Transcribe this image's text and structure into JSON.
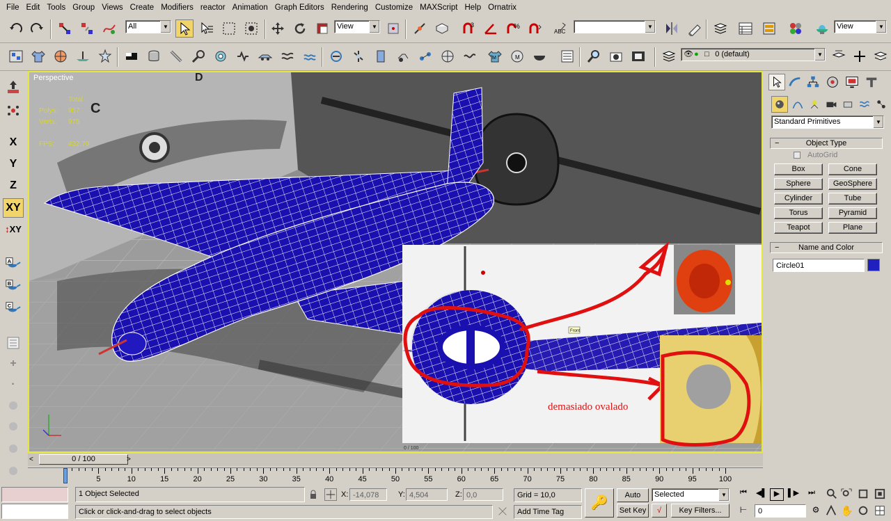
{
  "menu": [
    "File",
    "Edit",
    "Tools",
    "Group",
    "Views",
    "Create",
    "Modifiers",
    "reactor",
    "Animation",
    "Graph Editors",
    "Rendering",
    "Customize",
    "MAXScript",
    "Help",
    "Ornatrix"
  ],
  "toolbar": {
    "selection_filter": "All",
    "ref_coord": "View",
    "named_selection": "",
    "ref_coord2": "View",
    "layer": "0 (default)"
  },
  "left_strip": {
    "x": "X",
    "y": "Y",
    "z": "Z",
    "xy": "XY",
    "xy2": "XY",
    "a": "A",
    "b": "B",
    "c": "C"
  },
  "viewport": {
    "label": "Perspective",
    "stats_total": "Total",
    "stats_polys_label": "Polys:",
    "stats_polys": "957",
    "stats_verts_label": "Verts:",
    "stats_verts": "975",
    "stats_fps_label": "FPS:",
    "stats_fps": "432.79",
    "annotation": "demasiado ovalado",
    "front_label": "Front",
    "inset_frame": "0 / 100",
    "ref_letter_d": "D",
    "ref_letter_c": "C"
  },
  "command_panel": {
    "category": "Standard Primitives",
    "object_type_title": "Object Type",
    "autogrid": "AutoGrid",
    "buttons": [
      "Box",
      "Cone",
      "Sphere",
      "GeoSphere",
      "Cylinder",
      "Tube",
      "Torus",
      "Pyramid",
      "Teapot",
      "Plane"
    ],
    "name_color_title": "Name and Color",
    "object_name": "Circle01",
    "object_color": "#2020c0"
  },
  "timeline": {
    "frame": "0 / 100",
    "ticks": [
      "0",
      "5",
      "10",
      "15",
      "20",
      "25",
      "30",
      "35",
      "40",
      "45",
      "50",
      "55",
      "60",
      "65",
      "70",
      "75",
      "80",
      "85",
      "90",
      "95",
      "100"
    ]
  },
  "status": {
    "selection": "1 Object Selected",
    "prompt": "Click or click-and-drag to select objects",
    "x_label": "X:",
    "x": "-14,078",
    "y_label": "Y:",
    "y": "4,504",
    "z_label": "Z:",
    "z": "0,0",
    "grid": "Grid = 10,0",
    "add_time_tag": "Add Time Tag",
    "auto_key": "Auto Key",
    "set_key": "Set Key",
    "key_mode": "Selected",
    "key_filters": "Key Filters...",
    "current_frame": "0"
  },
  "colors": {
    "mesh": "#1a10b0",
    "viewport_border": "#e8e83a",
    "annotation": "#e01010"
  }
}
